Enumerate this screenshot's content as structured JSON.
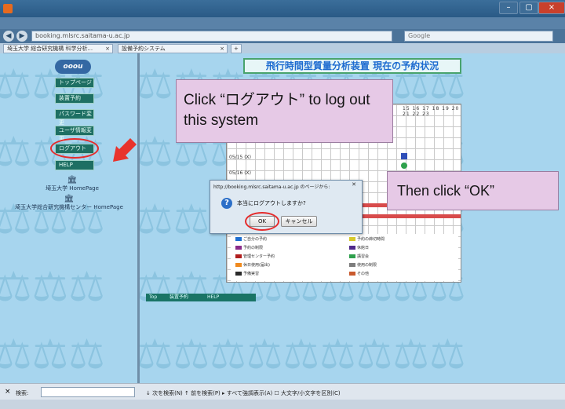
{
  "callouts": {
    "logout_instruction": "Click “ログアウト” to log out this system",
    "ok_instruction": "Then click “OK”"
  },
  "page": {
    "title": "飛行時間型質量分析装置 現在の予約状況"
  },
  "sidebar": {
    "logo": "ooou",
    "logout_label": "ログアウト",
    "help_label": "HELP",
    "links": [
      {
        "label": "トップページ"
      },
      {
        "label": "装置予約"
      },
      {
        "label": "パスワード変更"
      },
      {
        "label": "ユーザ情報変更"
      }
    ],
    "univ_home": "埼玉大学 HomePage",
    "center_home": "埼玉大学総合研究機構センター HomePage"
  },
  "browser": {
    "url": "booking.mlsrc.saitama-u.ac.jp",
    "search_placeholder": "Google",
    "tabs": [
      {
        "label": "埼玉大学 総合研究機構 科学分析..."
      },
      {
        "label": "設備予約システム"
      }
    ],
    "find_label": "検索:",
    "find_options": "↓ 次を検索(N)  ↑ 前を検索(P)  ▸ すべて強調表示(A)  ☐ 大文字/小文字を区別(C)"
  },
  "dialog": {
    "title": "http://booking.mlsrc.saitama-u.ac.jp のページから:",
    "message": "本当にログアウトしますか?",
    "ok": "OK",
    "cancel": "キャンセル"
  },
  "schedule": {
    "hours": "15 16 17 18 19 20 21 22 23",
    "rows": [
      "05/15 (X)",
      "05/16 (X)"
    ]
  },
  "legend": [
    {
      "label": "ご自分の予約",
      "color": "#1f6fd0"
    },
    {
      "label": "予約の制限",
      "color": "#8a2b8a"
    },
    {
      "label": "管理センター予約",
      "color": "#b01e1e"
    },
    {
      "label": "休日使用(届出)",
      "color": "#f08a1e"
    },
    {
      "label": "予備実習",
      "color": "#2b2b2b"
    },
    {
      "label": "予約の締切時間",
      "color": "#d7c92b"
    },
    {
      "label": "休館日",
      "color": "#4f2a8a"
    },
    {
      "label": "講習会",
      "color": "#2ea04c"
    },
    {
      "label": "使用の制限",
      "color": "#7d7d7d"
    },
    {
      "label": "その他",
      "color": "#c95a2e"
    }
  ],
  "footer_links": [
    "Top",
    "装置予約",
    "HELP"
  ],
  "colors": {
    "callout_bg": "#e6c9e6",
    "frame_bg": "#a7d5ee",
    "highlight_red": "#e52b2b"
  }
}
